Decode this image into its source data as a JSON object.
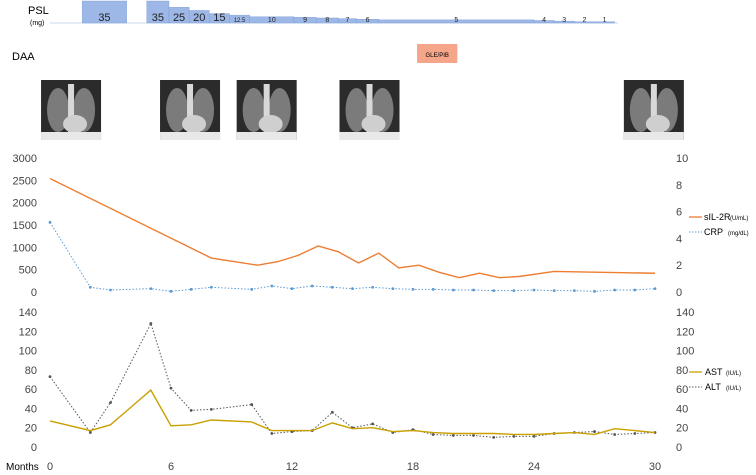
{
  "rows": {
    "psl_label": "PSL",
    "psl_unit": "(mg)",
    "daa_label": "DAA",
    "daa_drug": "GLE/PIB"
  },
  "psl_doses": [
    {
      "label": "35",
      "start": 1.6,
      "end": 3.8
    },
    {
      "label": "35",
      "start": 4.8,
      "end": 5.9
    },
    {
      "label": "25",
      "start": 5.9,
      "end": 6.9
    },
    {
      "label": "20",
      "start": 6.9,
      "end": 7.9
    },
    {
      "label": "15",
      "start": 7.9,
      "end": 8.9
    },
    {
      "label": "12.5",
      "start": 8.9,
      "end": 9.9
    },
    {
      "label": "10",
      "start": 9.9,
      "end": 12.1
    },
    {
      "label": "9",
      "start": 12.1,
      "end": 13.2
    },
    {
      "label": "8",
      "start": 13.2,
      "end": 14.3
    },
    {
      "label": "7",
      "start": 14.3,
      "end": 15.2
    },
    {
      "label": "6",
      "start": 15.2,
      "end": 16.3
    },
    {
      "label": "5",
      "start": 16.3,
      "end": 24.0
    },
    {
      "label": "4",
      "start": 24.0,
      "end": 25.0
    },
    {
      "label": "3",
      "start": 25.0,
      "end": 26.0
    },
    {
      "label": "2",
      "start": 26.0,
      "end": 27.0
    },
    {
      "label": "1",
      "start": 27.0,
      "end": 28.0
    }
  ],
  "daa_period": {
    "start": 18.2,
    "end": 20.2
  },
  "xray_months": [
    0.3,
    6.2,
    10.0,
    15.1,
    29.2
  ],
  "colors": {
    "psl_bar": "#9db7e6",
    "psl_bar_border": "#7b9cd6",
    "daa_bar": "#f4a58a",
    "sil2r": "#ed7d31",
    "crp": "#5b9bd5",
    "ast": "#c9a000",
    "alt": "#555555"
  },
  "chart_data": [
    {
      "type": "line",
      "x_label": "Months",
      "x_ticks": [
        "0",
        "6",
        "12",
        "18",
        "24",
        "30"
      ],
      "xlim": [
        0,
        30
      ],
      "y_left_ticks": [
        "3000",
        "2500",
        "2000",
        "1500",
        "1000",
        "500",
        "0"
      ],
      "y_right_ticks": [
        "10",
        "8",
        "6",
        "4",
        "2",
        "0"
      ],
      "ylim_left": [
        0,
        3000
      ],
      "ylim_right": [
        0,
        10
      ],
      "series": [
        {
          "name": "sIL-2R",
          "unit": "(U/mL)",
          "axis": "left",
          "x": [
            0,
            8,
            10.3,
            11.3,
            12.3,
            13.3,
            14.3,
            15.3,
            16.3,
            17.3,
            18.3,
            19.3,
            20.3,
            21.3,
            22.3,
            23.3,
            25,
            30
          ],
          "y": [
            2540,
            760,
            600,
            680,
            820,
            1030,
            900,
            650,
            870,
            540,
            600,
            440,
            320,
            420,
            320,
            350,
            460,
            420
          ]
        },
        {
          "name": "CRP",
          "unit": "(mg/dL)",
          "axis": "right",
          "x": [
            0,
            2,
            3,
            5,
            6,
            7,
            8,
            10,
            11,
            12,
            13,
            14,
            15,
            16,
            17,
            18,
            19,
            20,
            21,
            22,
            23,
            24,
            25,
            26,
            27,
            28,
            29,
            30
          ],
          "y": [
            5.2,
            0.35,
            0.15,
            0.25,
            0.05,
            0.2,
            0.35,
            0.2,
            0.45,
            0.25,
            0.45,
            0.35,
            0.25,
            0.35,
            0.25,
            0.2,
            0.2,
            0.15,
            0.15,
            0.1,
            0.1,
            0.15,
            0.1,
            0.1,
            0.05,
            0.15,
            0.15,
            0.25
          ]
        }
      ]
    },
    {
      "type": "line",
      "x_label": "Months",
      "xlim": [
        0,
        30
      ],
      "y_ticks": [
        "140",
        "120",
        "100",
        "80",
        "60",
        "40",
        "20",
        "0"
      ],
      "ylim": [
        0,
        140
      ],
      "series": [
        {
          "name": "AST",
          "unit": "(IU/L)",
          "x": [
            0,
            2,
            3,
            5,
            6,
            7,
            8,
            10,
            11,
            12,
            13,
            14,
            15,
            16,
            17,
            18,
            19,
            20,
            21,
            22,
            23,
            24,
            25,
            26,
            27,
            28,
            29,
            30
          ],
          "y": [
            27,
            17,
            23,
            59,
            22,
            23,
            28,
            26,
            17,
            17,
            17,
            25,
            19,
            20,
            16,
            17,
            15,
            14,
            14,
            14,
            13,
            13,
            14,
            15,
            13,
            19,
            17,
            15
          ],
          "style": "solid"
        },
        {
          "name": "ALT",
          "unit": "(IU/L)",
          "x": [
            0,
            2,
            3,
            5,
            6,
            7,
            8,
            10,
            11,
            12,
            13,
            14,
            15,
            16,
            17,
            18,
            19,
            20,
            21,
            22,
            23,
            24,
            25,
            26,
            27,
            28,
            29,
            30
          ],
          "y": [
            73,
            15,
            46,
            128,
            61,
            38,
            39,
            44,
            14,
            16,
            17,
            36,
            20,
            24,
            15,
            18,
            13,
            12,
            12,
            10,
            11,
            11,
            14,
            15,
            16,
            13,
            14,
            15
          ],
          "style": "dotted"
        }
      ]
    }
  ]
}
